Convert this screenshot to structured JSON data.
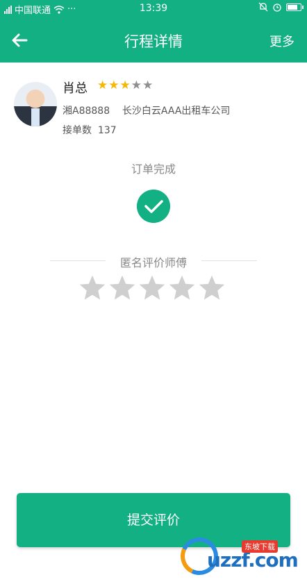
{
  "status_bar": {
    "carrier": "中国联通",
    "time": "13:39"
  },
  "nav": {
    "title": "行程详情",
    "more": "更多"
  },
  "driver": {
    "name": "肖总",
    "rating": 3,
    "rating_max": 5,
    "plate_company": "湘A88888    长沙白云AAA出租车公司",
    "orders_label": "接单数",
    "orders_count": "137"
  },
  "order": {
    "status": "订单完成"
  },
  "review": {
    "label": "匿名评价师傅",
    "stars_selected": 0,
    "stars_max": 5
  },
  "actions": {
    "submit": "提交评价"
  },
  "watermark": {
    "text": "uzzf.com",
    "badge": "东坡下载"
  },
  "colors": {
    "primary": "#12b083",
    "star_on": "#f5b800",
    "star_off": "#8f8f8f",
    "star_empty": "#cfcfcf"
  }
}
